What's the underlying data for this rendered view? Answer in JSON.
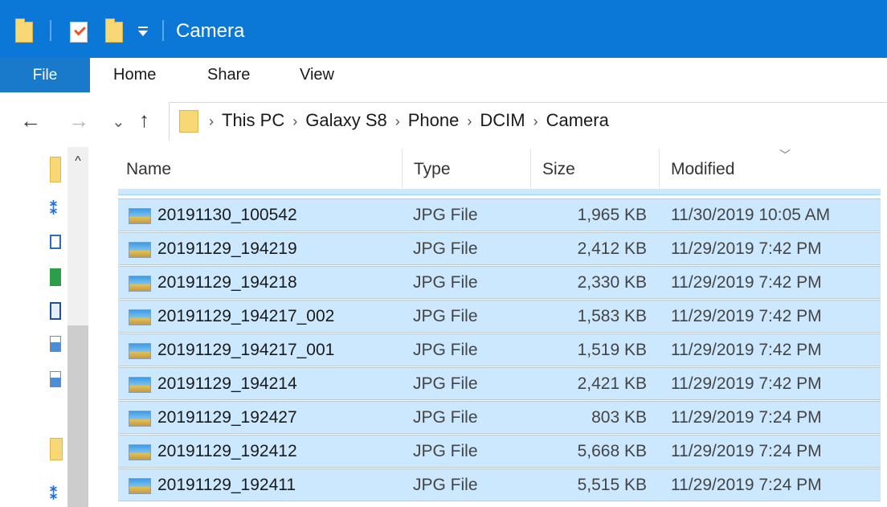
{
  "window": {
    "title": "Camera",
    "accent_color": "#0b78d7",
    "selection_color": "#cce8ff"
  },
  "quick_access_icons": [
    "folder-icon",
    "properties-icon",
    "new-folder-icon",
    "customize-dropdown-icon"
  ],
  "ribbon": {
    "file": "File",
    "tabs": [
      "Home",
      "Share",
      "View"
    ]
  },
  "nav_buttons": {
    "back": "←",
    "forward": "→",
    "recent": "⌄",
    "up": "↑"
  },
  "address": {
    "crumbs": [
      "This PC",
      "Galaxy S8",
      "Phone",
      "DCIM",
      "Camera"
    ],
    "separator": "›"
  },
  "columns": {
    "name": "Name",
    "type": "Type",
    "size": "Size",
    "modified": "Modified"
  },
  "files": [
    {
      "name": "20191130_100542",
      "type": "JPG File",
      "size": "1,965 KB",
      "modified": "11/30/2019 10:05 AM"
    },
    {
      "name": "20191129_194219",
      "type": "JPG File",
      "size": "2,412 KB",
      "modified": "11/29/2019 7:42 PM"
    },
    {
      "name": "20191129_194218",
      "type": "JPG File",
      "size": "2,330 KB",
      "modified": "11/29/2019 7:42 PM"
    },
    {
      "name": "20191129_194217_002",
      "type": "JPG File",
      "size": "1,583 KB",
      "modified": "11/29/2019 7:42 PM"
    },
    {
      "name": "20191129_194217_001",
      "type": "JPG File",
      "size": "1,519 KB",
      "modified": "11/29/2019 7:42 PM"
    },
    {
      "name": "20191129_194214",
      "type": "JPG File",
      "size": "2,421 KB",
      "modified": "11/29/2019 7:42 PM"
    },
    {
      "name": "20191129_192427",
      "type": "JPG File",
      "size": "803 KB",
      "modified": "11/29/2019 7:24 PM"
    },
    {
      "name": "20191129_192412",
      "type": "JPG File",
      "size": "5,668 KB",
      "modified": "11/29/2019 7:24 PM"
    },
    {
      "name": "20191129_192411",
      "type": "JPG File",
      "size": "5,515 KB",
      "modified": "11/29/2019 7:24 PM"
    }
  ]
}
